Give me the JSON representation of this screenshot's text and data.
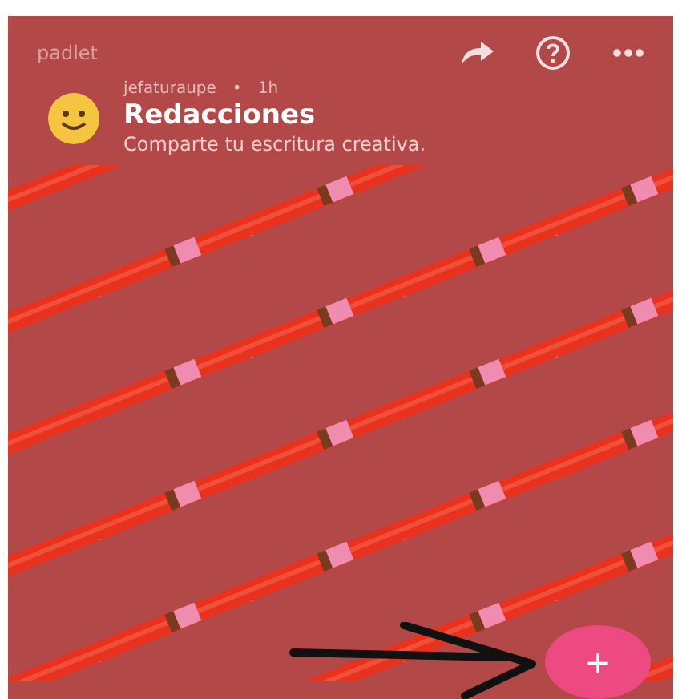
{
  "app_bar": {
    "logo": "padlet"
  },
  "post": {
    "author": "jefaturaupe",
    "separator": "•",
    "time": "1h",
    "title": "Redacciones",
    "description": "Comparte tu escritura creativa."
  },
  "fab": {
    "label": "+"
  }
}
